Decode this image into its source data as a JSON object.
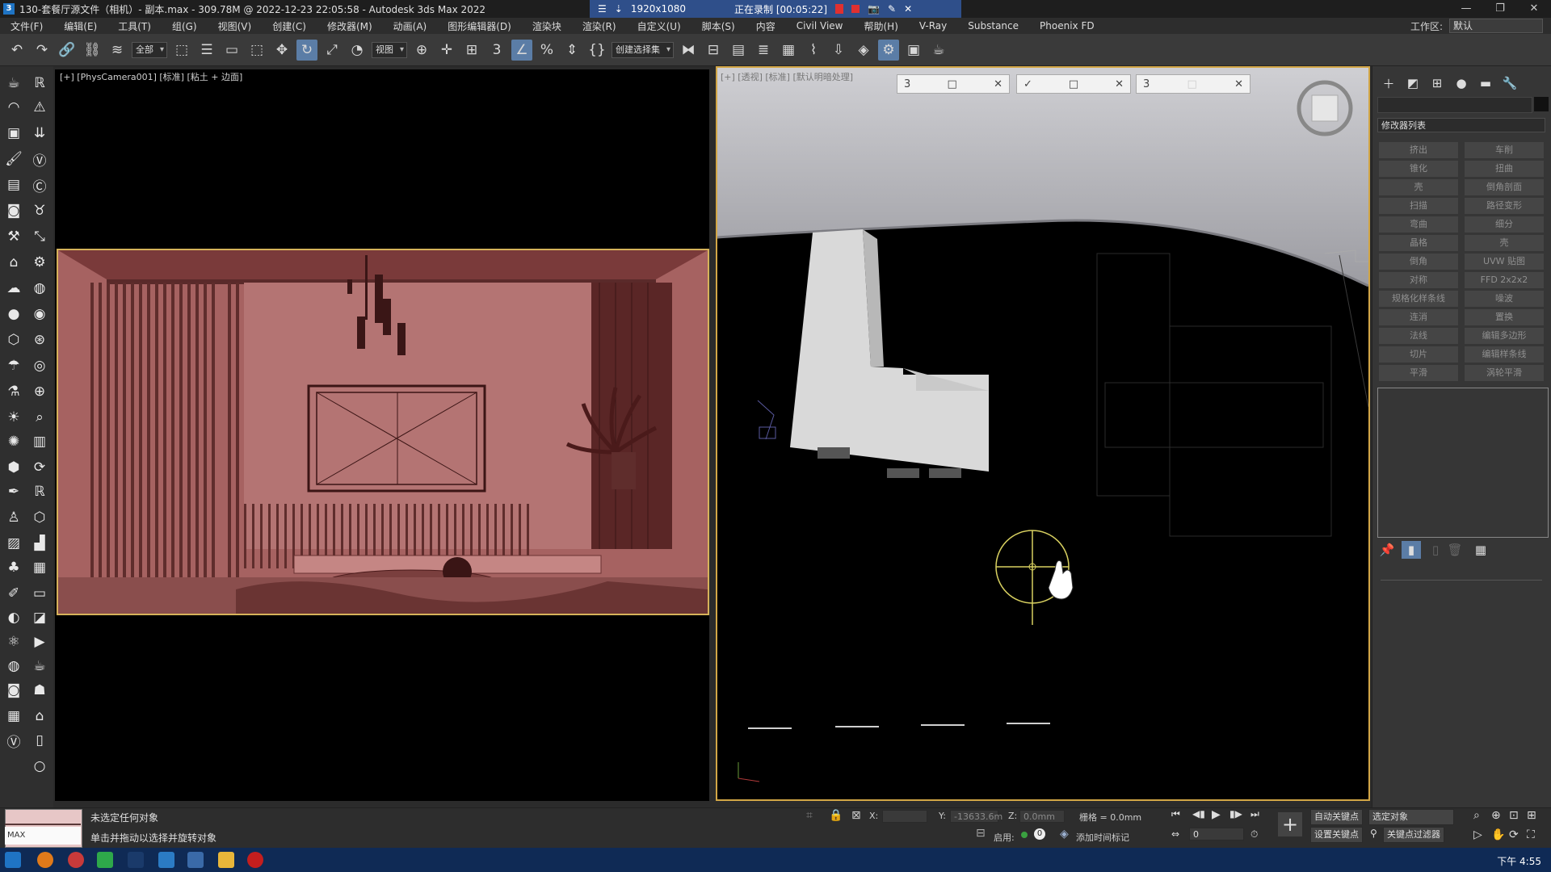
{
  "titlebar": {
    "title": "130-套餐厅源文件（相机）- 副本.max - 309.78M @ 2022-12-23 22:05:58 - Autodesk 3ds Max 2022",
    "app_icon_label": "3",
    "resolution": "1920x1080",
    "recording": "正在录制 [00:05:22]"
  },
  "menu": [
    "文件(F)",
    "编辑(E)",
    "工具(T)",
    "组(G)",
    "视图(V)",
    "创建(C)",
    "修改器(M)",
    "动画(A)",
    "图形编辑器(D)",
    "渲染块",
    "渲染(R)",
    "自定义(U)",
    "脚本(S)",
    "内容",
    "Civil View",
    "帮助(H)",
    "V-Ray",
    "Substance",
    "Phoenix FD"
  ],
  "workspace": {
    "label": "工作区:",
    "value": "默认"
  },
  "toolbar": {
    "filter_select": "全部",
    "view_select": "视图",
    "selection_set": "创建选择集",
    "snap_number": "3",
    "angle_snap": "%"
  },
  "viewport_left": {
    "label": "[+] [PhysCamera001] [标准] [粘土 + 边面]"
  },
  "viewport_right": {
    "label": "[+] [透视] [标准] [默认明暗处理]"
  },
  "float_windows": [
    {
      "icon": "3",
      "buttons": [
        "□",
        "✕"
      ]
    },
    {
      "icon": "✓",
      "buttons": [
        "□",
        "✕"
      ]
    },
    {
      "icon": "3",
      "buttons": [
        "□",
        "✕"
      ]
    }
  ],
  "command_panel": {
    "modifier_list": "修改器列表",
    "modifiers": [
      "挤出",
      "车削",
      "锥化",
      "扭曲",
      "壳",
      "倒角剖面",
      "扫描",
      "路径变形",
      "弯曲",
      "细分",
      "晶格",
      "壳",
      "倒角",
      "UVW 贴图",
      "对称",
      "FFD 2x2x2",
      "规格化样条线",
      "噪波",
      "连消",
      "置换",
      "法线",
      "编辑多边形",
      "切片",
      "编辑样条线",
      "平滑",
      "涡轮平滑"
    ]
  },
  "status": {
    "selection": "未选定任何对象",
    "hint": "单击并拖动以选择并旋转对象",
    "maxscript": "MAX",
    "x_label": "X:",
    "x_value": "",
    "y_label": "Y:",
    "y_value": "-13633.6m",
    "z_label": "Z:",
    "z_value": "0.0mm",
    "grid": "栅格 = 0.0mm",
    "enable_label": "启用:",
    "add_time_tag": "添加时间标记",
    "frame_value": "0",
    "auto_key": "自动关键点",
    "set_key": "设置关键点",
    "selected_object": "选定对象",
    "key_filter": "关键点过滤器"
  },
  "taskbar": {
    "clock": "下午 4:55"
  },
  "colors": {
    "render_bg": "#a8605f",
    "viewport_border": "#d6b25a",
    "gizmo": "#d8d060",
    "recbar": "#2f4f8a"
  }
}
